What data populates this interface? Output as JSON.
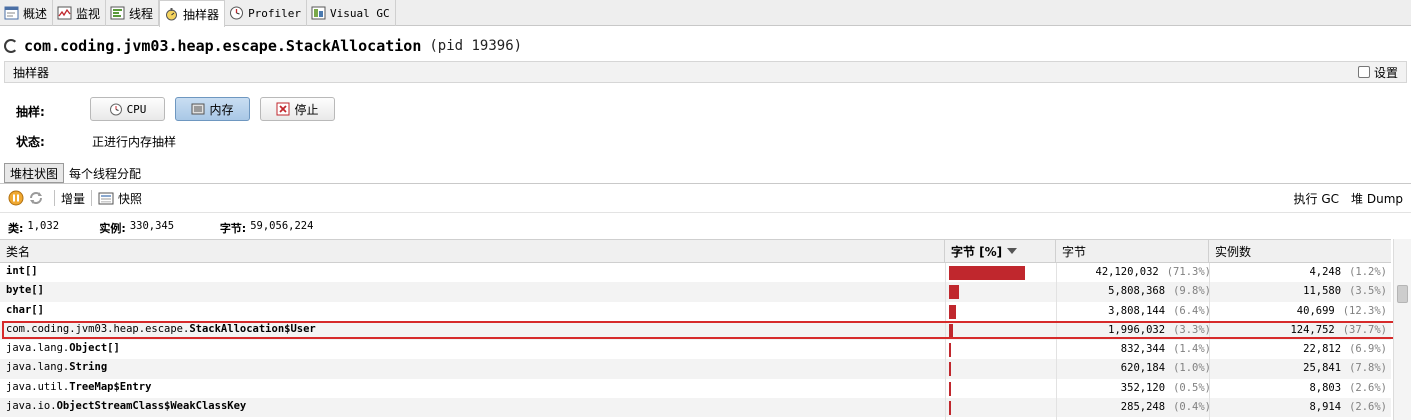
{
  "tabs": [
    {
      "label": "概述",
      "icon": "overview-icon"
    },
    {
      "label": "监视",
      "icon": "monitor-icon"
    },
    {
      "label": "线程",
      "icon": "threads-icon"
    },
    {
      "label": "抽样器",
      "icon": "sampler-icon",
      "active": true
    },
    {
      "label": "Profiler",
      "icon": "profiler-icon"
    },
    {
      "label": "Visual GC",
      "icon": "visual-gc-icon"
    }
  ],
  "header": {
    "title": "com.coding.jvm03.heap.escape.StackAllocation",
    "pid": "(pid 19396)"
  },
  "section": {
    "title": "抽样器",
    "settings_label": "设置"
  },
  "sampling": {
    "sample_label": "抽样:",
    "cpu_label": "CPU",
    "memory_label": "内存",
    "stop_label": "停止",
    "status_label": "状态:",
    "status_value": "正进行内存抽样"
  },
  "view_tabs": [
    "堆柱状图",
    "每个线程分配"
  ],
  "toolbar": {
    "delta_label": "增量",
    "snapshot_label": "快照",
    "gc_label": "执行 GC",
    "heap_dump_label": "堆 Dump"
  },
  "summary": {
    "classes_label": "类:",
    "classes_value": "1,032",
    "instances_label": "实例:",
    "instances_value": "330,345",
    "bytes_label": "字节:",
    "bytes_value": "59,056,224"
  },
  "table": {
    "columns": [
      "类名",
      "字节 [%]",
      "字节",
      "实例数"
    ],
    "rows": [
      {
        "prefix": "",
        "name": "int[]",
        "bytes": "42,120,032",
        "bytes_pct": "(71.3%)",
        "bar": 0.713,
        "instances": "4,248",
        "inst_pct": "(1.2%)"
      },
      {
        "prefix": "",
        "name": "byte[]",
        "bytes": "5,808,368",
        "bytes_pct": "(9.8%)",
        "bar": 0.098,
        "instances": "11,580",
        "inst_pct": "(3.5%)"
      },
      {
        "prefix": "",
        "name": "char[]",
        "bytes": "3,808,144",
        "bytes_pct": "(6.4%)",
        "bar": 0.064,
        "instances": "40,699",
        "inst_pct": "(12.3%)"
      },
      {
        "prefix": "com.coding.jvm03.heap.escape.",
        "name": "StackAllocation$User",
        "bytes": "1,996,032",
        "bytes_pct": "(3.3%)",
        "bar": 0.033,
        "instances": "124,752",
        "inst_pct": "(37.7%)",
        "highlight": true
      },
      {
        "prefix": "java.lang.",
        "name": "Object[]",
        "bytes": "832,344",
        "bytes_pct": "(1.4%)",
        "bar": 0.014,
        "instances": "22,812",
        "inst_pct": "(6.9%)"
      },
      {
        "prefix": "java.lang.",
        "name": "String",
        "bytes": "620,184",
        "bytes_pct": "(1.0%)",
        "bar": 0.01,
        "instances": "25,841",
        "inst_pct": "(7.8%)"
      },
      {
        "prefix": "java.util.",
        "name": "TreeMap$Entry",
        "bytes": "352,120",
        "bytes_pct": "(0.5%)",
        "bar": 0.005,
        "instances": "8,803",
        "inst_pct": "(2.6%)"
      },
      {
        "prefix": "java.io.",
        "name": "ObjectStreamClass$WeakClassKey",
        "bytes": "285,248",
        "bytes_pct": "(0.4%)",
        "bar": 0.004,
        "instances": "8,914",
        "inst_pct": "(2.6%)"
      }
    ]
  },
  "colors": {
    "bar": "#c0272d",
    "highlight_border": "#d62a2a",
    "pressed_button": "#a9c8e6"
  }
}
